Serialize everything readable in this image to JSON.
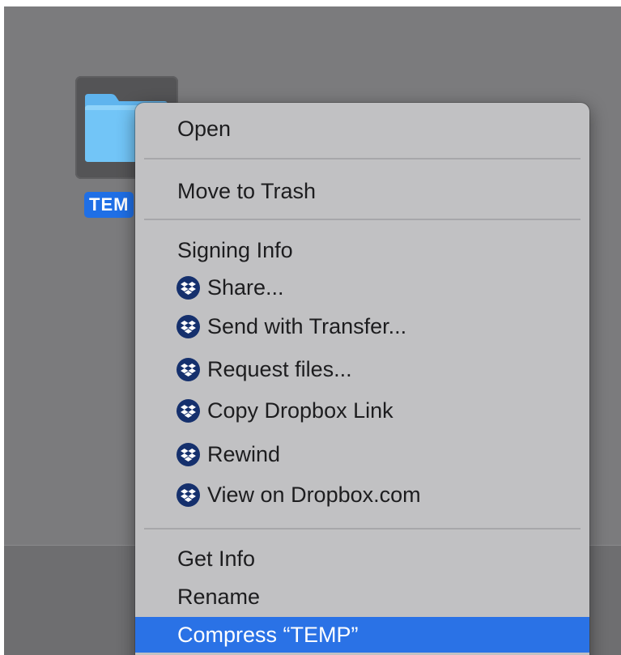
{
  "desktop": {
    "folder": {
      "label": "TEMP",
      "label_visible": "TEM",
      "selected": true,
      "icon": "folder-icon",
      "color": "#6ec2f5"
    }
  },
  "context_menu": {
    "groups": [
      [
        {
          "label": "Open"
        }
      ],
      [
        {
          "label": "Move to Trash"
        }
      ],
      [
        {
          "label": "Signing Info"
        },
        {
          "label": "Share...",
          "icon": "dropbox-icon"
        },
        {
          "label": "Send with Transfer...",
          "icon": "dropbox-icon"
        },
        {
          "label": "Request files...",
          "icon": "dropbox-icon"
        },
        {
          "label": "Copy Dropbox Link",
          "icon": "dropbox-icon"
        },
        {
          "label": "Rewind",
          "icon": "dropbox-icon"
        },
        {
          "label": "View on Dropbox.com",
          "icon": "dropbox-icon"
        }
      ],
      [
        {
          "label": "Get Info"
        },
        {
          "label": "Rename"
        },
        {
          "label": "Compress “TEMP”",
          "highlighted": true
        }
      ]
    ]
  },
  "colors": {
    "highlight": "#2a72e6",
    "menu_background": "#c1c1c3",
    "dropbox_icon": "#15306d",
    "desktop_background": "#7b7b7d"
  }
}
